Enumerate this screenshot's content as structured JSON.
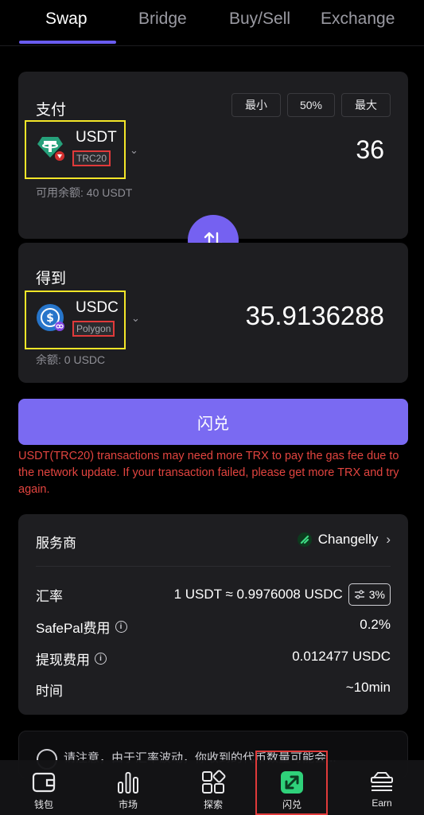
{
  "tabs": [
    {
      "label": "Swap",
      "active": true
    },
    {
      "label": "Bridge",
      "active": false
    },
    {
      "label": "Buy/Sell",
      "active": false
    },
    {
      "label": "Exchange",
      "active": false
    }
  ],
  "pay": {
    "title": "支付",
    "min_label": "最小",
    "half_label": "50%",
    "max_label": "最大",
    "token": "USDT",
    "network": "TRC20",
    "amount": "36",
    "balance": "可用余额: 40 USDT"
  },
  "receive": {
    "title": "得到",
    "token": "USDC",
    "network": "Polygon",
    "amount": "35.9136288",
    "balance": "余额: 0 USDC"
  },
  "action": {
    "swap_label": "闪兑",
    "warning": "USDT(TRC20) transactions may need more TRX to pay the gas fee due to the network update. If your transaction failed, please get more TRX and try again."
  },
  "info": {
    "provider_label": "服务商",
    "provider_value": "Changelly",
    "rate_label": "汇率",
    "rate_value": "1 USDT ≈ 0.9976008 USDC",
    "slippage": "3%",
    "safepal_fee_label": "SafePal费用",
    "safepal_fee_value": "0.2%",
    "withdraw_fee_label": "提现费用",
    "withdraw_fee_value": "0.012477 USDC",
    "time_label": "时间",
    "time_value": "~10min"
  },
  "notice": {
    "text": "请注意，由于汇率波动，你收到的代币数量可能会..."
  },
  "nav": [
    {
      "label": "钱包",
      "icon": "wallet-icon"
    },
    {
      "label": "市场",
      "icon": "market-chart-icon"
    },
    {
      "label": "探索",
      "icon": "explore-grid-icon"
    },
    {
      "label": "闪兑",
      "icon": "swap-icon",
      "active": true
    },
    {
      "label": "Earn",
      "icon": "earn-icon"
    }
  ],
  "colors": {
    "accent": "#7561f1",
    "warning": "#e2443f",
    "annotation_yellow": "#f4e628",
    "annotation_red": "#e03a3a"
  }
}
